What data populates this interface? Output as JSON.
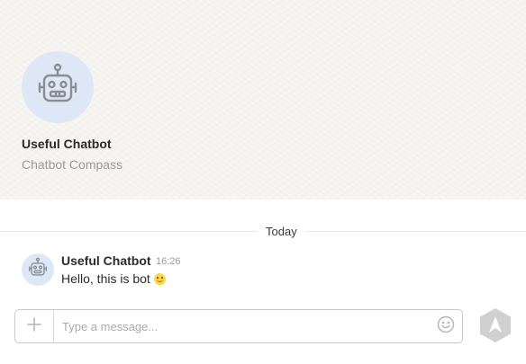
{
  "header": {
    "bot_name": "Useful Chatbot",
    "bot_subtitle": "Chatbot Compass",
    "avatar_icon": "robot-icon"
  },
  "conversation": {
    "date_divider": "Today",
    "messages": [
      {
        "author": "Useful Chatbot",
        "time": "16:26",
        "text": "Hello, this is bot",
        "emoji": "smiling-face-emoji",
        "avatar_icon": "robot-icon"
      }
    ]
  },
  "composer": {
    "add_icon": "plus-icon",
    "input_placeholder": "Type a message...",
    "input_value": "",
    "emoji_icon": "smiley-icon",
    "send_icon": "send-icon"
  },
  "colors": {
    "header_bg": "#f8f6f2",
    "avatar_bg": "#dde7f5",
    "icon_gray": "#8a8f96",
    "send_gray": "#d0d0d0"
  }
}
